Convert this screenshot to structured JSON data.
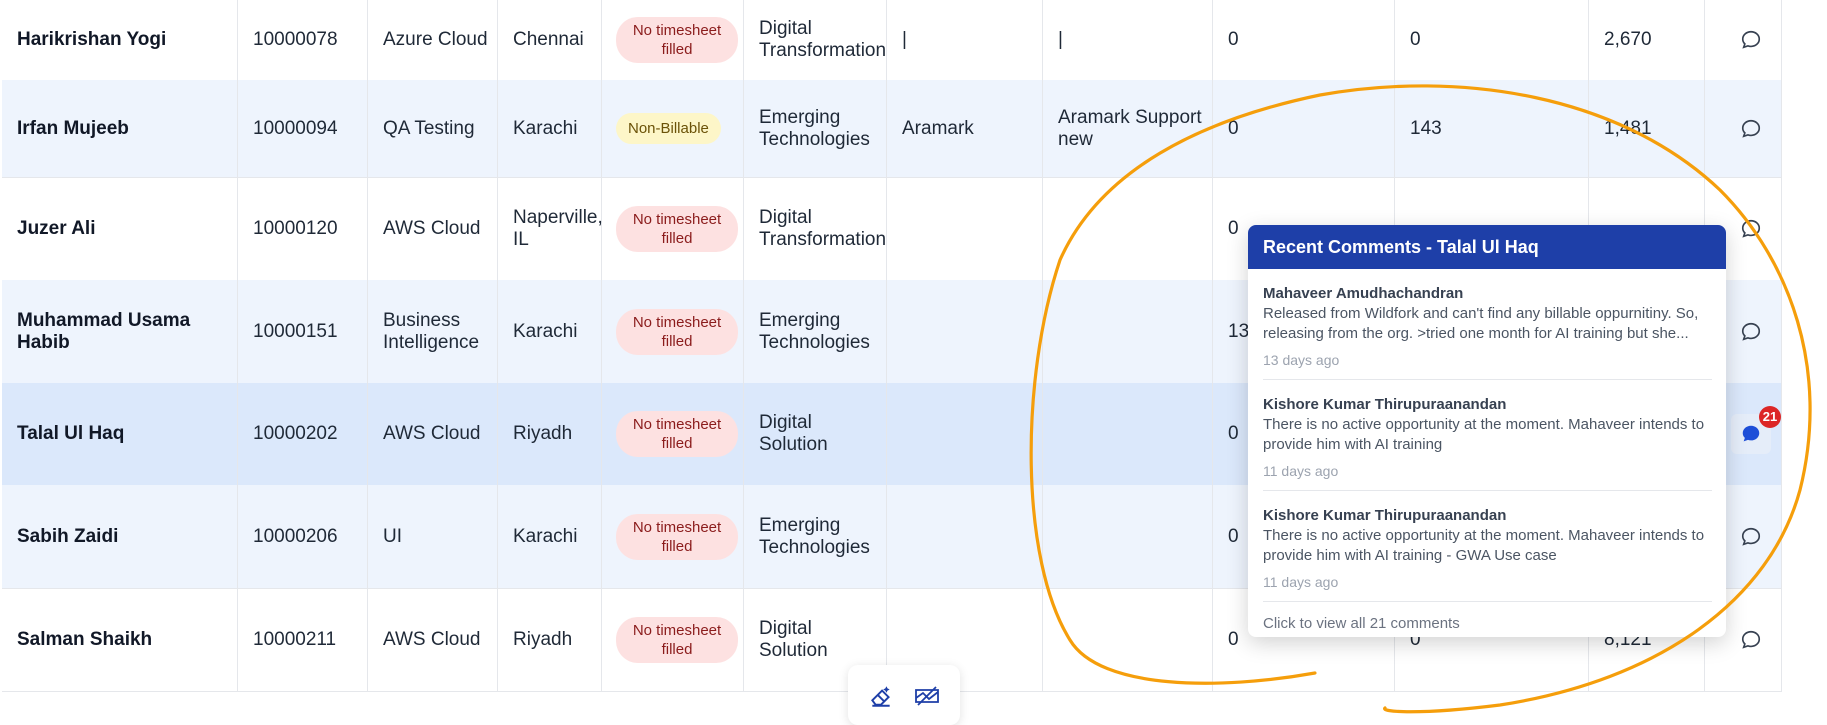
{
  "rows": [
    {
      "name": "Harikrishan Yogi",
      "id": "10000078",
      "skill": "Azure Cloud",
      "loc": "Chennai",
      "status": "No timesheet filled",
      "status_type": "red",
      "bu": "Digital Transformation",
      "client": "|",
      "project": "|",
      "n1": "0",
      "n2": "0",
      "n3": "2,670"
    },
    {
      "name": "Irfan Mujeeb",
      "id": "10000094",
      "skill": "QA Testing",
      "loc": "Karachi",
      "status": "Non-Billable",
      "status_type": "yellow",
      "bu": "Emerging Technologies",
      "client": "Aramark",
      "project": "Aramark Support new",
      "n1": "0",
      "n2": "143",
      "n3": "1,481"
    },
    {
      "name": "Juzer Ali",
      "id": "10000120",
      "skill": "AWS Cloud",
      "loc": "Naperville, IL",
      "status": "No timesheet filled",
      "status_type": "red",
      "bu": "Digital Transformation",
      "client": "",
      "project": "",
      "n1": "0",
      "n2": "",
      "n3": ""
    },
    {
      "name": "Muhammad Usama Habib",
      "id": "10000151",
      "skill": "Business Intelligence",
      "loc": "Karachi",
      "status": "No timesheet filled",
      "status_type": "red",
      "bu": "Emerging Technologies",
      "client": "",
      "project": "",
      "n1": "13(",
      "n2": "",
      "n3": ""
    },
    {
      "name": "Talal Ul Haq",
      "id": "10000202",
      "skill": "AWS Cloud",
      "loc": "Riyadh",
      "status": "No timesheet filled",
      "status_type": "red",
      "bu": "Digital Solution",
      "client": "",
      "project": "",
      "n1": "0",
      "n2": "",
      "n3": ""
    },
    {
      "name": "Sabih Zaidi",
      "id": "10000206",
      "skill": "UI",
      "loc": "Karachi",
      "status": "No timesheet filled",
      "status_type": "red",
      "bu": "Emerging Technologies",
      "client": "",
      "project": "",
      "n1": "0",
      "n2": "",
      "n3": ""
    },
    {
      "name": "Salman Shaikh",
      "id": "10000211",
      "skill": "AWS Cloud",
      "loc": "Riyadh",
      "status": "No timesheet filled",
      "status_type": "red",
      "bu": "Digital Solution",
      "client": "",
      "project": "",
      "n1": "0",
      "n2": "0",
      "n3": "8,121"
    }
  ],
  "selected_row_comment_count": "21",
  "popup": {
    "title": "Recent Comments - Talal Ul Haq",
    "comments": [
      {
        "author": "Mahaveer Amudhachandran",
        "text": "Released from Wildfork and can't find any billable oppurnitiny. So, releasing from the org. >tried one month for AI training but she...",
        "time": "13 days ago"
      },
      {
        "author": "Kishore Kumar Thirupuraanandan",
        "text": "There is no active opportunity at the moment. Mahaveer intends to provide him with AI training",
        "time": "11 days ago"
      },
      {
        "author": "Kishore Kumar Thirupuraanandan",
        "text": "There is no active opportunity at the moment. Mahaveer intends to provide him with AI training - GWA Use case",
        "time": "11 days ago"
      }
    ],
    "view_all": "Click to view all 21 comments"
  },
  "icons": {
    "chat": "chat-bubble-icon",
    "eraser": "eraser-icon",
    "clear": "clear-annotations-icon"
  },
  "colors": {
    "accent": "#1e3fa8",
    "annotation": "#f59e0b",
    "badge_red": "#fde1e1",
    "badge_yellow": "#fdf6c8"
  }
}
